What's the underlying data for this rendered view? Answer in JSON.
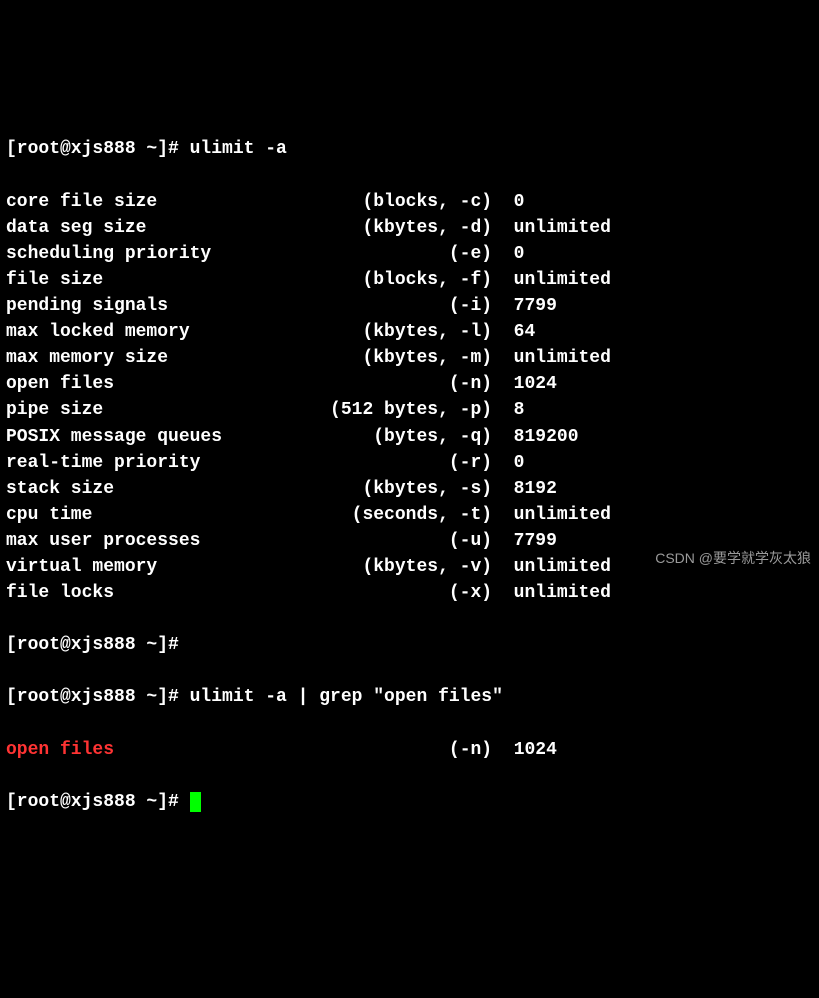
{
  "prompt1": "[root@xjs888 ~]# ulimit -a",
  "rows": [
    {
      "label": "core file size",
      "spec": "(blocks, -c)",
      "value": "0",
      "pad1": 24,
      "pad2": 21
    },
    {
      "label": "data seg size",
      "spec": "(kbytes, -d)",
      "value": "unlimited",
      "pad1": 24,
      "pad2": 21
    },
    {
      "label": "scheduling priority",
      "spec": "(-e)",
      "value": "0",
      "pad1": 24,
      "pad2": 21
    },
    {
      "label": "file size",
      "spec": "(blocks, -f)",
      "value": "unlimited",
      "pad1": 24,
      "pad2": 21
    },
    {
      "label": "pending signals",
      "spec": "(-i)",
      "value": "7799",
      "pad1": 24,
      "pad2": 21
    },
    {
      "label": "max locked memory",
      "spec": "(kbytes, -l)",
      "value": "64",
      "pad1": 24,
      "pad2": 21
    },
    {
      "label": "max memory size",
      "spec": "(kbytes, -m)",
      "value": "unlimited",
      "pad1": 24,
      "pad2": 21
    },
    {
      "label": "open files",
      "spec": "(-n)",
      "value": "1024",
      "pad1": 24,
      "pad2": 21
    },
    {
      "label": "pipe size",
      "spec": "(512 bytes, -p)",
      "value": "8",
      "pad1": 24,
      "pad2": 21
    },
    {
      "label": "POSIX message queues",
      "spec": "(bytes, -q)",
      "value": "819200",
      "pad1": 24,
      "pad2": 21
    },
    {
      "label": "real-time priority",
      "spec": "(-r)",
      "value": "0",
      "pad1": 24,
      "pad2": 21
    },
    {
      "label": "stack size",
      "spec": "(kbytes, -s)",
      "value": "8192",
      "pad1": 24,
      "pad2": 21
    },
    {
      "label": "cpu time",
      "spec": "(seconds, -t)",
      "value": "unlimited",
      "pad1": 24,
      "pad2": 21
    },
    {
      "label": "max user processes",
      "spec": "(-u)",
      "value": "7799",
      "pad1": 24,
      "pad2": 21
    },
    {
      "label": "virtual memory",
      "spec": "(kbytes, -v)",
      "value": "unlimited",
      "pad1": 24,
      "pad2": 21
    },
    {
      "label": "file locks",
      "spec": "(-x)",
      "value": "unlimited",
      "pad1": 24,
      "pad2": 21
    }
  ],
  "prompt_empty": "[root@xjs888 ~]# ",
  "prompt2": "[root@xjs888 ~]# ulimit -a | grep \"open files\"",
  "grep_row": {
    "label": "open files",
    "spec": "(-n)",
    "value": "1024",
    "pad1": 24,
    "pad2": 21
  },
  "prompt3": "[root@xjs888 ~]# ",
  "watermark": "CSDN @要学就学灰太狼"
}
